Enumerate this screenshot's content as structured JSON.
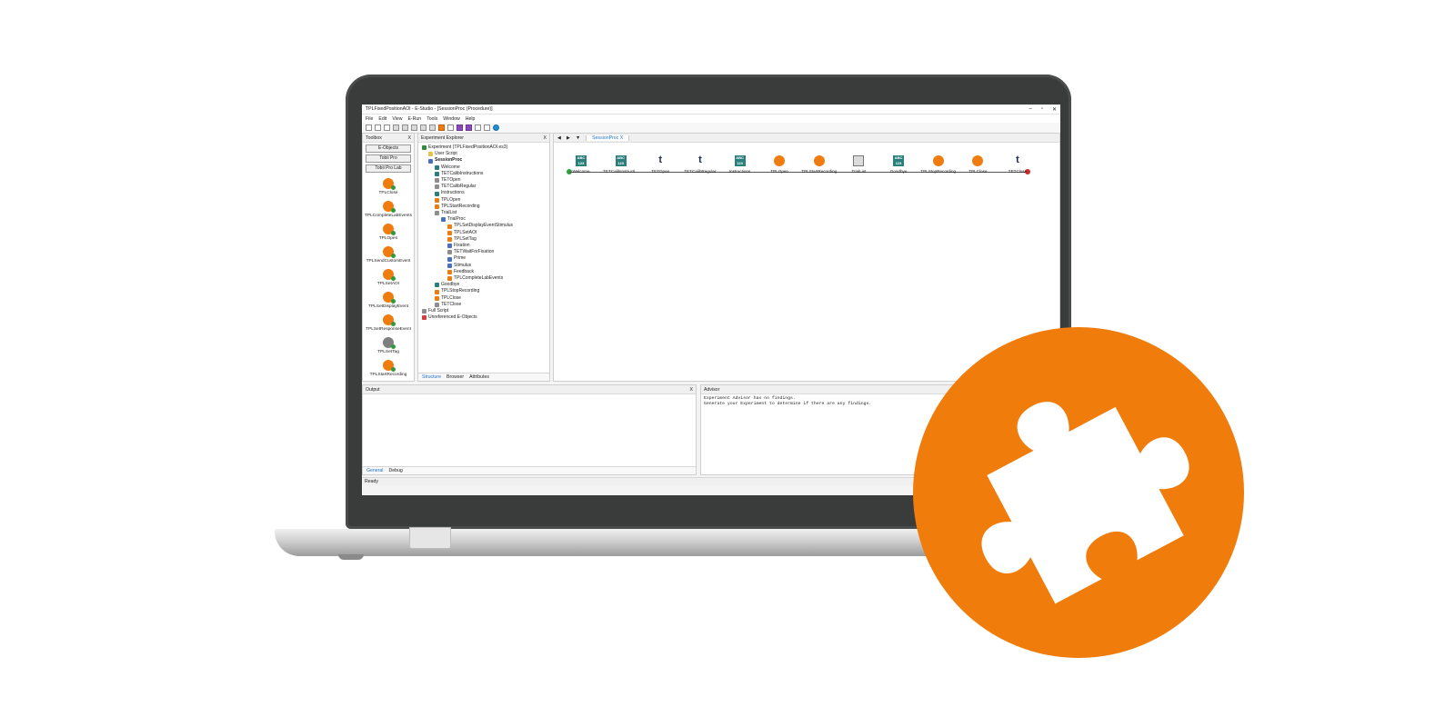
{
  "window": {
    "title": "TPLFixedPositionAOI - E-Studio - [SessionProc (Procedure)]",
    "controls": [
      "–",
      "▫",
      "✕"
    ]
  },
  "menu": [
    "File",
    "Edit",
    "View",
    "E-Run",
    "Tools",
    "Window",
    "Help"
  ],
  "toolbox": {
    "title": "Toolbox",
    "close": "X",
    "categories": [
      "E-Objects",
      "Tobii Pro",
      "Tobii Pro Lab"
    ],
    "items": [
      "TPLClose",
      "TPLCompleteLabEvents",
      "TPLOpen",
      "TPLSendCustomEvent",
      "TPLSetAOI",
      "TPLSetDisplayEvent",
      "TPLSetResponseEvent",
      "TPLSetTag",
      "TPLStartRecording"
    ]
  },
  "explorer": {
    "title": "Experiment Explorer",
    "close": "X",
    "tree": [
      {
        "label": "Experiment (TPLFixedPositionAOI.es3)",
        "indent": 0,
        "icon": "green"
      },
      {
        "label": "User Script",
        "indent": 1,
        "icon": "yellow"
      },
      {
        "label": "SessionProc",
        "indent": 1,
        "icon": "blue"
      },
      {
        "label": "Welcome",
        "indent": 2,
        "icon": "teal"
      },
      {
        "label": "TETCalibInstructions",
        "indent": 2,
        "icon": "teal"
      },
      {
        "label": "TETOpen",
        "indent": 2,
        "icon": "gray"
      },
      {
        "label": "TETCalibRegular",
        "indent": 2,
        "icon": "gray"
      },
      {
        "label": "Instructions",
        "indent": 2,
        "icon": "teal"
      },
      {
        "label": "TPLOpen",
        "indent": 2,
        "icon": "orange"
      },
      {
        "label": "TPLStartRecording",
        "indent": 2,
        "icon": "orange"
      },
      {
        "label": "TrialList",
        "indent": 2,
        "icon": "gray"
      },
      {
        "label": "TrialProc",
        "indent": 3,
        "icon": "blue"
      },
      {
        "label": "TPLSetDisplayEventStimulus",
        "indent": 4,
        "icon": "orange"
      },
      {
        "label": "TPLSetAOI",
        "indent": 4,
        "icon": "orange"
      },
      {
        "label": "TPLSetTag",
        "indent": 4,
        "icon": "orange"
      },
      {
        "label": "Fixation",
        "indent": 4,
        "icon": "blue"
      },
      {
        "label": "TETWaitForFixation",
        "indent": 4,
        "icon": "gray"
      },
      {
        "label": "Prime",
        "indent": 4,
        "icon": "blue"
      },
      {
        "label": "Stimulus",
        "indent": 4,
        "icon": "blue"
      },
      {
        "label": "Feedback",
        "indent": 4,
        "icon": "orange"
      },
      {
        "label": "TPLCompleteLabEvents",
        "indent": 4,
        "icon": "orange"
      },
      {
        "label": "Goodbye",
        "indent": 2,
        "icon": "teal"
      },
      {
        "label": "TPLStopRecording",
        "indent": 2,
        "icon": "orange"
      },
      {
        "label": "TPLClose",
        "indent": 2,
        "icon": "orange"
      },
      {
        "label": "TETClose",
        "indent": 2,
        "icon": "gray"
      },
      {
        "label": "Full Script",
        "indent": 0,
        "icon": "gray"
      },
      {
        "label": "Unreferenced E-Objects",
        "indent": 0,
        "icon": "red"
      }
    ],
    "tabs": [
      "Structure",
      "Browser",
      "Attributes"
    ]
  },
  "document": {
    "tab": "SessionProc",
    "close": "X",
    "timeline": [
      {
        "label": "Welcome",
        "type": "abc"
      },
      {
        "label": "TETCalibInstructi...",
        "type": "abc"
      },
      {
        "label": "TETOpen",
        "type": "tet"
      },
      {
        "label": "TETCalibRegular",
        "type": "tet"
      },
      {
        "label": "Instructions",
        "type": "abc"
      },
      {
        "label": "TPLOpen",
        "type": "tpl"
      },
      {
        "label": "TPLStartRecording",
        "type": "tpl"
      },
      {
        "label": "TrialList",
        "type": "list"
      },
      {
        "label": "Goodbye",
        "type": "abc"
      },
      {
        "label": "TPLStopRecording",
        "type": "tpl"
      },
      {
        "label": "TPLClose",
        "type": "tpl"
      },
      {
        "label": "TETClose",
        "type": "tet"
      }
    ],
    "abc_glyph": "ABC 123",
    "tet_glyph": "t"
  },
  "output": {
    "title": "Output",
    "close": "X",
    "tabs": [
      "General",
      "Debug"
    ]
  },
  "advisor": {
    "title": "Advisor",
    "lines": [
      "Experiment Advisor has no findings.",
      "Generate your Experiment to determine if there are any findings."
    ]
  },
  "status": "Ready",
  "colors": {
    "brand_orange": "#f07c0b",
    "laptop_bezel": "#3a3b3b"
  },
  "badge_icon": "puzzle-piece-icon"
}
